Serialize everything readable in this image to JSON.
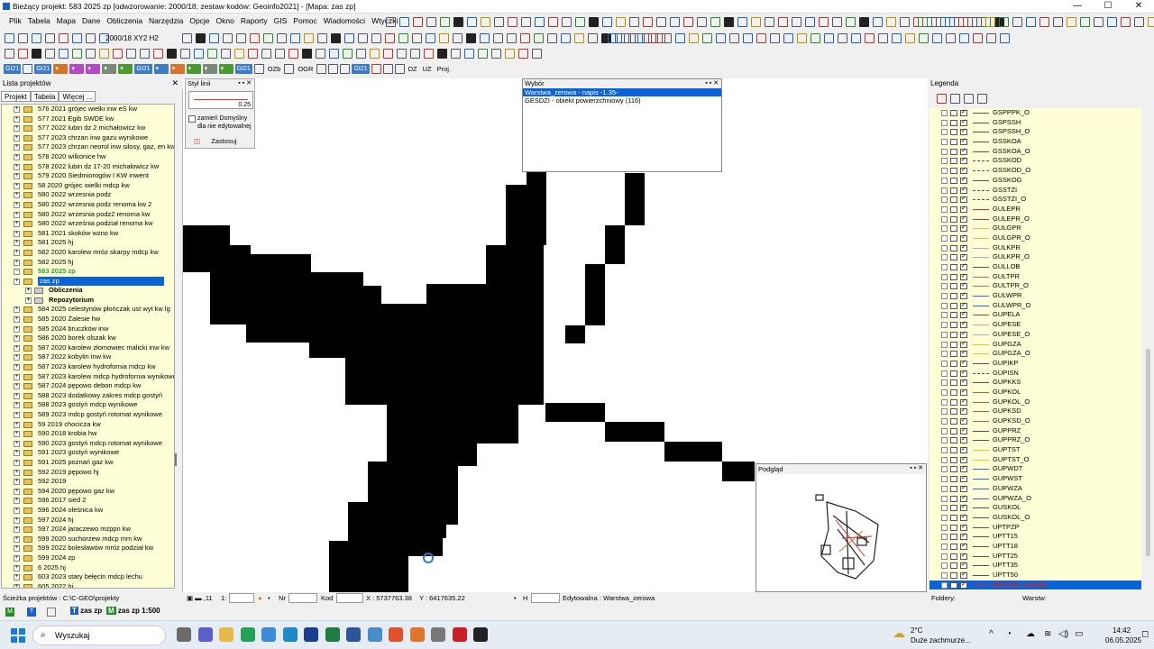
{
  "window": {
    "title": "Bieżący projekt: 583 2025 zp [odwzorowanie: 2000/18; zestaw kodów: Geoinfo2021] - [Mapa: zas zp]",
    "controls": [
      "—",
      "☐",
      "✕"
    ]
  },
  "menu": [
    "Plik",
    "Tabela",
    "Mapa",
    "Dane",
    "Obliczenia",
    "Narzędzia",
    "Opcje",
    "Okno",
    "Raporty",
    "GIS",
    "Pomoc",
    "Wiadomości",
    "Wtyczki"
  ],
  "toolbar": {
    "coord_system": "2000/18 XY2 H2"
  },
  "gi21": {
    "ozb": "OZb",
    "ogr": "OGR",
    "dz": "DZ",
    "uz": "UZ",
    "proj": "Proj."
  },
  "left_panel": {
    "title": "Lista projektów",
    "tabs": [
      "Projekt",
      "Tabela",
      "Więcej ..."
    ],
    "items": [
      {
        "label": "576 2021 grójec wielki inw eS kw"
      },
      {
        "label": "577 2021 Egib SWDE kw"
      },
      {
        "label": "577 2022 lubin dz 2 michałowicz kw"
      },
      {
        "label": "577 2023 chrzan inw gazu wynikowe"
      },
      {
        "label": "577 2023 chrzan neorol inw silosy, gaz, en kw"
      },
      {
        "label": "578 2020 wilkonice hw"
      },
      {
        "label": "578 2022 lubin dz 17-20 michałowicz kw"
      },
      {
        "label": "579 2020 Siedmiorogów I KW inwent"
      },
      {
        "label": "58 2020 grójec wielki mdcp kw"
      },
      {
        "label": "580 2022 wrzesnia podz"
      },
      {
        "label": "580 2022 wrzesnia podz renoma kw 2"
      },
      {
        "label": "580 2022 wrzesnia podz2 renoma kw"
      },
      {
        "label": "580 2022 września podział renoma kw"
      },
      {
        "label": "581 2021 skoków wzno kw"
      },
      {
        "label": "581 2025 hj"
      },
      {
        "label": "582 2020 karolew mróz skarpy mdcp kw"
      },
      {
        "label": "582 2025 hj"
      },
      {
        "label": "583 2025 zp",
        "cur": true
      },
      {
        "label": "zas zp",
        "sel": true
      },
      {
        "label": "Obliczenia",
        "sub": true
      },
      {
        "label": "Repozytorium",
        "sub": true
      },
      {
        "label": "584 2025 celestynów płończak ust wyt kw lg"
      },
      {
        "label": "585 2020 Zalesie hw"
      },
      {
        "label": "585 2024 bruczków inw"
      },
      {
        "label": "586 2020 borek olszak kw"
      },
      {
        "label": "587 2020 karolew złomowiec malicki inw kw"
      },
      {
        "label": "587 2022 kobylin inw kw"
      },
      {
        "label": "587 2023 karolew hydrofornia mdcp kw"
      },
      {
        "label": "587 2023 karolew mdcp hydrofornia wynikowe"
      },
      {
        "label": "587 2024 pępowo debon mdcp kw"
      },
      {
        "label": "588 2023 dodatkowy zakres mdcp gostyń"
      },
      {
        "label": "588 2023 gostyń mdcp wynikowe"
      },
      {
        "label": "589 2023 mdcp gostyń rotomat wynikowe"
      },
      {
        "label": "59 2019 chocicza kw"
      },
      {
        "label": "590 2018 krobia hw"
      },
      {
        "label": "590 2023 gostyń mdcp rotomat wynikowe"
      },
      {
        "label": "591 2023 gostyń wynikowe"
      },
      {
        "label": "591 2025 poznań gaz kw"
      },
      {
        "label": "592 2019 pępowo hj"
      },
      {
        "label": "592 2019"
      },
      {
        "label": "594 2020 pępowo gaz kw"
      },
      {
        "label": "596 2017 sied 2"
      },
      {
        "label": "596 2024 oleśnica kw"
      },
      {
        "label": "597 2024 hj"
      },
      {
        "label": "597 2024 jaraczewo mzppn kw"
      },
      {
        "label": "599 2020 suchorzew mdcp mm kw"
      },
      {
        "label": "599 2022 bolesławów mróz podział kw"
      },
      {
        "label": "599 2024 zp"
      },
      {
        "label": "6 2025 hj"
      },
      {
        "label": "603 2023 stary bełęcin mdcp lechu"
      },
      {
        "label": "605 2022 hj"
      }
    ]
  },
  "styl": {
    "title": "Styl linii",
    "value": "0.25",
    "checkbox": "zamień Domyślny dla nie edytowalnej",
    "apply": "Zastosuj"
  },
  "wybor": {
    "title": "Wybór",
    "items": [
      "Warstwa_zerowa - napis -1.35-",
      "GESDZI - obiekt powierzchniowy (116)"
    ]
  },
  "podglad": {
    "title": "Podgląd"
  },
  "legend": {
    "title": "Legenda",
    "colors": {
      "sel_text": "#e02020"
    },
    "layers": [
      {
        "name": "GSPPPK_O",
        "c": "#555"
      },
      {
        "name": "GSPSSH",
        "c": "#555"
      },
      {
        "name": "GSPSSH_O",
        "c": "#555"
      },
      {
        "name": "GSSKOA",
        "c": "#555"
      },
      {
        "name": "GSSKOA_O",
        "c": "#555"
      },
      {
        "name": "GSSKOD",
        "c": "#555",
        "d": true
      },
      {
        "name": "GSSKOD_O",
        "c": "#555",
        "d": true
      },
      {
        "name": "GSSKOG",
        "c": "#555"
      },
      {
        "name": "GSSTZI",
        "c": "#555",
        "d": true
      },
      {
        "name": "GSSTZI_O",
        "c": "#555",
        "d": true
      },
      {
        "name": "GULEPR",
        "c": "#c33"
      },
      {
        "name": "GULEPR_O",
        "c": "#c33"
      },
      {
        "name": "GULGPR",
        "c": "#cc3"
      },
      {
        "name": "GULGPR_O",
        "c": "#cc3"
      },
      {
        "name": "GULKPR",
        "c": "#c9c"
      },
      {
        "name": "GULKPR_O",
        "c": "#c9c"
      },
      {
        "name": "GULLOB",
        "c": "#555"
      },
      {
        "name": "GULTPR",
        "c": "#c66"
      },
      {
        "name": "GULTPR_O",
        "c": "#c66"
      },
      {
        "name": "GULWPR",
        "c": "#36c"
      },
      {
        "name": "GULWPR_O",
        "c": "#36c"
      },
      {
        "name": "GUPELA",
        "c": "#c33"
      },
      {
        "name": "GUPESE",
        "c": "#c9c"
      },
      {
        "name": "GUPESE_O",
        "c": "#c9c"
      },
      {
        "name": "GUPGZA",
        "c": "#cc3"
      },
      {
        "name": "GUPGZA_O",
        "c": "#cc3"
      },
      {
        "name": "GUPIKP",
        "c": "#555"
      },
      {
        "name": "GUPISN",
        "c": "#555",
        "d": true
      },
      {
        "name": "GUPKKS",
        "c": "#555"
      },
      {
        "name": "GUPKOL",
        "c": "#a63"
      },
      {
        "name": "GUPKOL_O",
        "c": "#a63"
      },
      {
        "name": "GUPKSD",
        "c": "#a63"
      },
      {
        "name": "GUPKSD_O",
        "c": "#a63"
      },
      {
        "name": "GUPPRZ",
        "c": "#555"
      },
      {
        "name": "GUPPRZ_O",
        "c": "#555"
      },
      {
        "name": "GUPTST",
        "c": "#cc3"
      },
      {
        "name": "GUPTST_O",
        "c": "#cc3"
      },
      {
        "name": "GUPWDT",
        "c": "#36c"
      },
      {
        "name": "GUPWST",
        "c": "#36c"
      },
      {
        "name": "GUPWZA",
        "c": "#36c"
      },
      {
        "name": "GUPWZA_O",
        "c": "#36c"
      },
      {
        "name": "GUSKOL",
        "c": "#555"
      },
      {
        "name": "GUSKOL_O",
        "c": "#555"
      },
      {
        "name": "UPTPZP",
        "c": "#555"
      },
      {
        "name": "UPTT15",
        "c": "#555"
      },
      {
        "name": "UPTT18",
        "c": "#555"
      },
      {
        "name": "UPTT25",
        "c": "#555"
      },
      {
        "name": "UPTT35",
        "c": "#555"
      },
      {
        "name": "UPTT50",
        "c": "#555"
      },
      {
        "name": "Warstwa_zerowa",
        "c": "#e02020",
        "sel": true
      }
    ]
  },
  "status": {
    "path": "Ścieżka projektów : C:\\C-GEO\\projekty",
    "scale_label": "1:",
    "nr": "Nr",
    "kod": "Kod",
    "x": "X : 5737763.38",
    "y": "Y : 6417635.22",
    "h": "H",
    "editable": "Edytowalna : Warstwa_zerowa",
    "folders": "Foldery:",
    "layers": "Warstw:"
  },
  "bottom_tabs": [
    "zas zp",
    "zas zp 1:500"
  ],
  "taskbar": {
    "search": "Wyszukaj",
    "weather_temp": "2°C",
    "weather_text": "Duże zachmurze...",
    "time": "14:42",
    "date": "06.05.2025"
  }
}
